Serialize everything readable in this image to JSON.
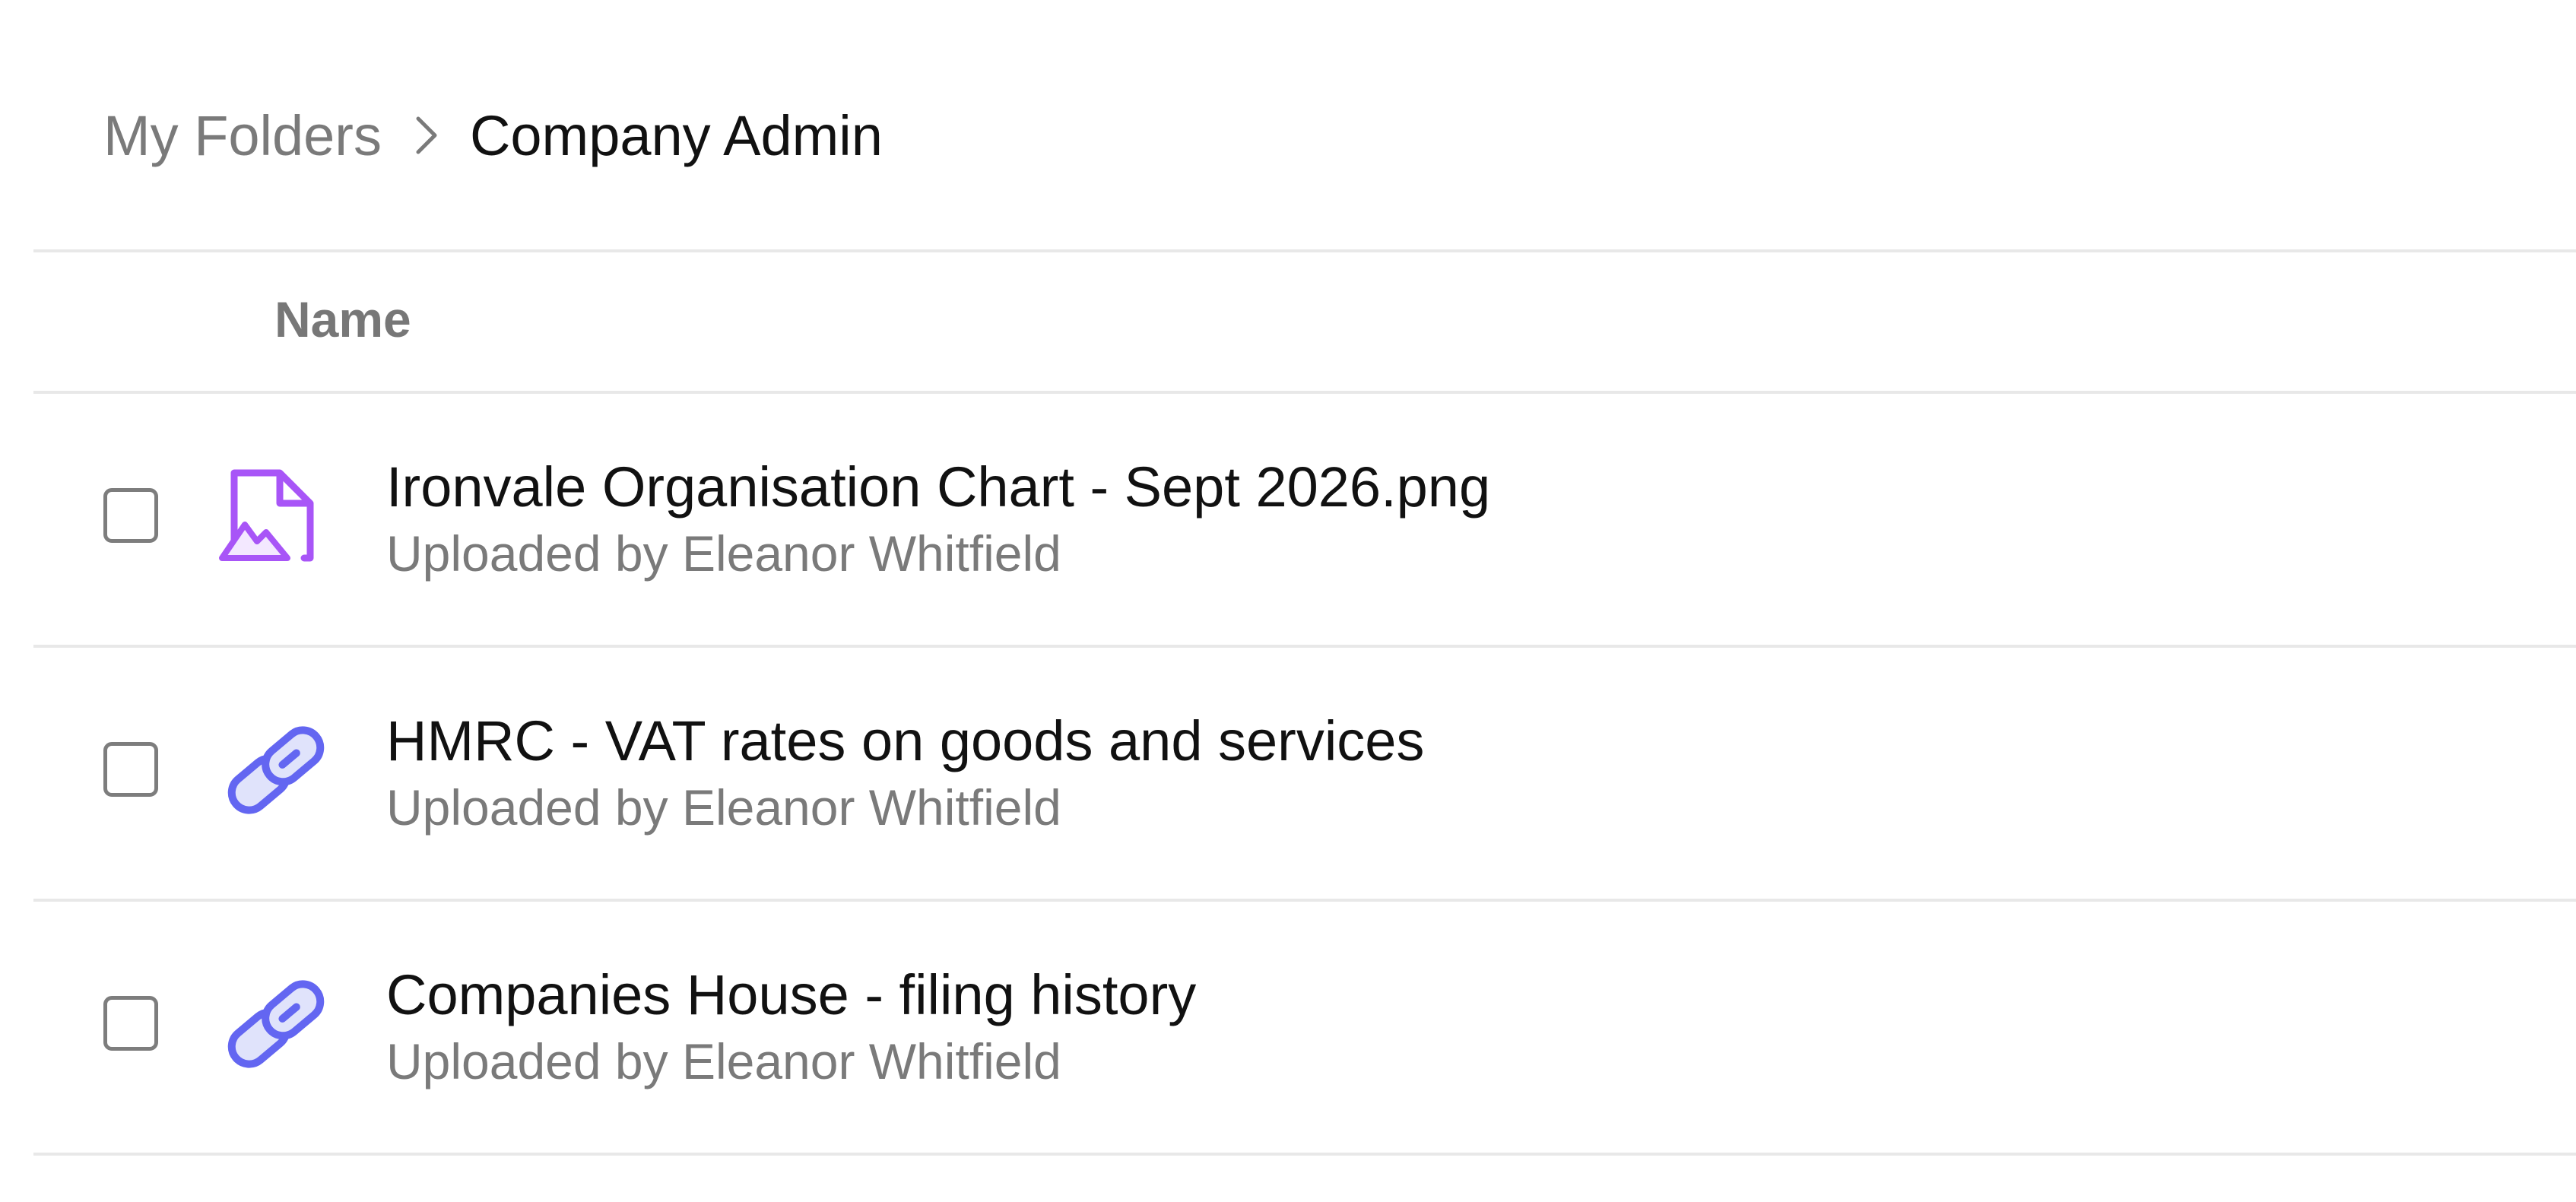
{
  "breadcrumb": {
    "parent": "My Folders",
    "current": "Company Admin"
  },
  "table": {
    "column_name": "Name",
    "rows": [
      {
        "name": "Ironvale Organisation Chart - Sept 2026.png",
        "meta": "Uploaded by Eleanor Whitfield",
        "icon": "image-file-icon"
      },
      {
        "name": "HMRC - VAT rates on goods and services",
        "meta": "Uploaded by Eleanor Whitfield",
        "icon": "link-icon"
      },
      {
        "name": "Companies House - filing history",
        "meta": "Uploaded by Eleanor Whitfield",
        "icon": "link-icon"
      }
    ]
  },
  "colors": {
    "image_icon": "#a855f7",
    "link_icon_stroke": "#6366f1",
    "link_icon_fill": "#e0e3fb"
  }
}
